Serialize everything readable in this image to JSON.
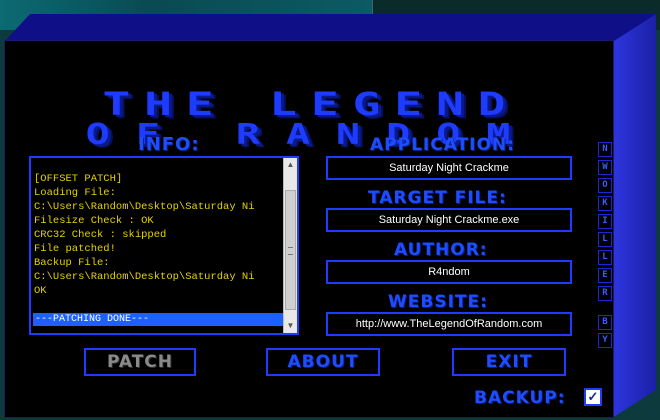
{
  "title": {
    "line1": "THE LEGEND",
    "line2": "OF RANDOM"
  },
  "info": {
    "heading": "INFO:",
    "lines": [
      "[OFFSET PATCH]",
      "Loading File:",
      "C:\\Users\\Random\\Desktop\\Saturday Ni",
      "Filesize Check : OK",
      "CRC32 Check : skipped",
      "File patched!",
      "Backup File:",
      "C:\\Users\\Random\\Desktop\\Saturday Ni",
      "OK"
    ],
    "status_line": "---PATCHING DONE---"
  },
  "application": {
    "heading": "APPLICATION:",
    "value": "Saturday Night Crackme"
  },
  "target_file": {
    "heading": "TARGET FILE:",
    "value": "Saturday Night Crackme.exe"
  },
  "author": {
    "heading": "AUTHOR:",
    "value": "R4ndom"
  },
  "website": {
    "heading": "WEBSITE:",
    "value": "http://www.TheLegendOfRandom.com"
  },
  "buttons": {
    "patch": "PATCH",
    "about": "ABOUT",
    "exit": "EXIT"
  },
  "backup": {
    "label": "BACKUP:",
    "checked": true
  },
  "side_strip": {
    "credit": [
      "N",
      "W",
      "O",
      "K",
      "I",
      "L",
      "L",
      "E",
      "R"
    ],
    "by": [
      "B",
      "Y"
    ]
  },
  "colors": {
    "accent": "#1e3cff",
    "log_text": "#e6d200",
    "selection": "#1e60ff"
  }
}
